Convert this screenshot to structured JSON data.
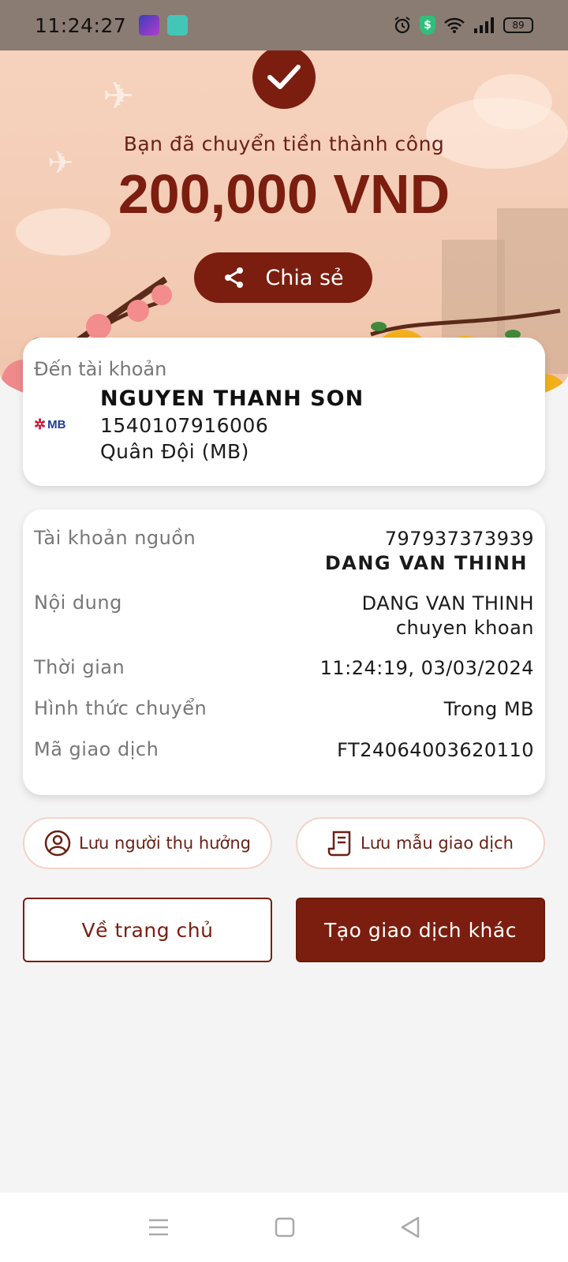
{
  "status_bar": {
    "time": "11:24:27",
    "battery": "89",
    "icons": [
      "app-icon-1",
      "app-icon-2",
      "alarm-icon",
      "shield-dollar-icon",
      "wifi-icon",
      "signal-icon",
      "battery-icon"
    ]
  },
  "success": {
    "title": "Bạn đã chuyển tiền thành công",
    "amount": "200,000 VND",
    "share_label": "Chia sẻ"
  },
  "recipient": {
    "label": "Đến tài khoản",
    "bank_logo": "MB",
    "name": "NGUYEN THANH SON",
    "account": "1540107916006",
    "bank": "Quân Đội (MB)"
  },
  "details": {
    "source_label": "Tài khoản nguồn",
    "source_account": "797937373939",
    "source_name": "DANG VAN THINH",
    "content_label": "Nội dung",
    "content_line1": "DANG VAN THINH",
    "content_line2": "chuyen khoan",
    "time_label": "Thời gian",
    "time_value": "11:24:19, 03/03/2024",
    "method_label": "Hình thức chuyển",
    "method_value": "Trong MB",
    "txn_label": "Mã giao dịch",
    "txn_value": "FT24064003620110"
  },
  "actions": {
    "save_beneficiary": "Lưu người thụ hưởng",
    "save_template": "Lưu mẫu giao dịch",
    "home": "Về trang chủ",
    "new_transaction": "Tạo giao dịch khác"
  },
  "colors": {
    "brand": "#7b1e0f",
    "hero_bg": "#f6d2bd",
    "page_bg": "#f5f4f4"
  }
}
